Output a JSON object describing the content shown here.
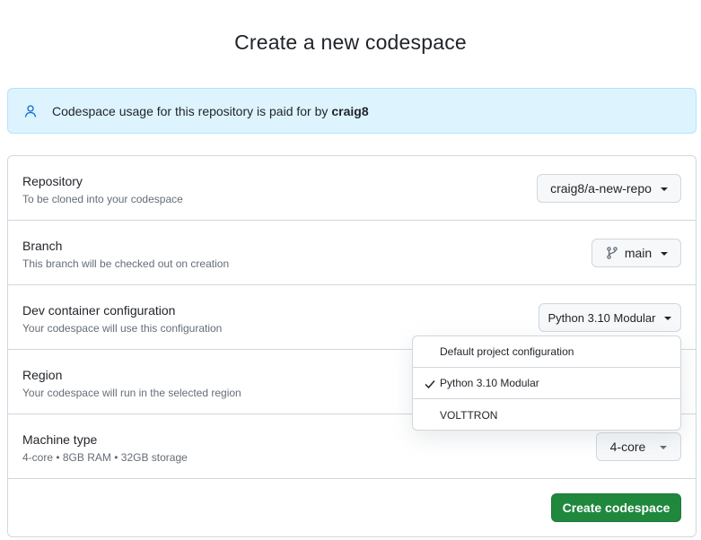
{
  "page": {
    "title": "Create a new codespace"
  },
  "notice": {
    "icon": "person-icon",
    "text": "Codespace usage for this repository is paid for by",
    "owner": "craig8"
  },
  "rows": {
    "repository": {
      "title": "Repository",
      "subtitle": "To be cloned into your codespace",
      "value": "craig8/a-new-repo"
    },
    "branch": {
      "title": "Branch",
      "subtitle": "This branch will be checked out on creation",
      "value": "main",
      "icon": "git-branch-icon"
    },
    "devcontainer": {
      "title": "Dev container configuration",
      "subtitle": "Your codespace will use this configuration",
      "value": "Python 3.10 Modular"
    },
    "region": {
      "title": "Region",
      "subtitle": "Your codespace will run in the selected region"
    },
    "machine": {
      "title": "Machine type",
      "subtitle": "4-core • 8GB RAM • 32GB storage",
      "value": "4-core"
    }
  },
  "dropdown": {
    "options": [
      {
        "label": "Default project configuration",
        "selected": false
      },
      {
        "label": "Python 3.10 Modular",
        "selected": true
      },
      {
        "label": "VOLTTRON",
        "selected": false
      }
    ]
  },
  "actions": {
    "create_label": "Create codespace"
  },
  "colors": {
    "notice_bg": "#ddf4ff",
    "notice_icon": "#0969da",
    "primary_button": "#1f883d",
    "border": "#d0d7de",
    "muted_text": "#656d76"
  }
}
